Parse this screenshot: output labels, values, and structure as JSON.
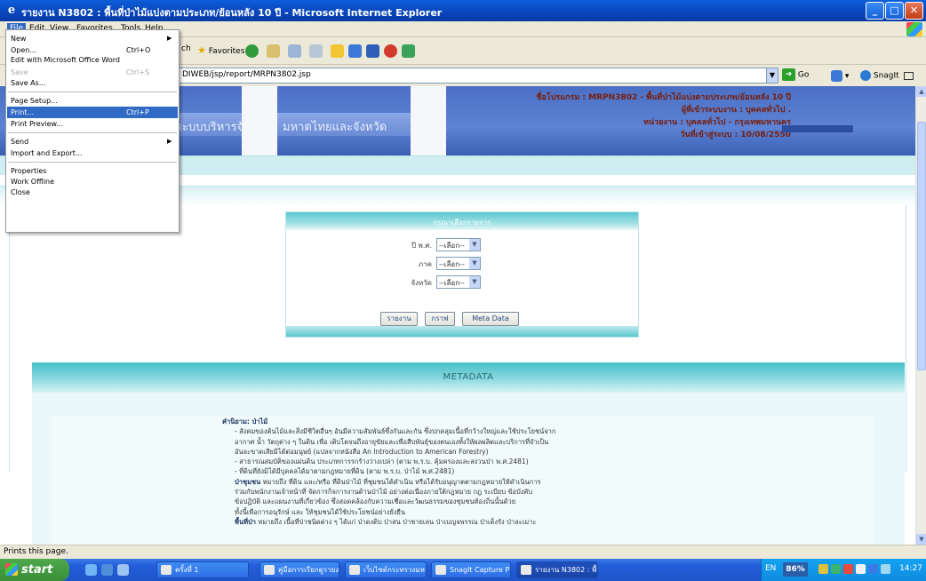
{
  "window": {
    "title": "รายงาน N3802 : พื้นที่ป่าไม้แบ่งตามประเภท/ย้อนหลัง 10 ปี - Microsoft Internet Explorer",
    "min_glyph": "_",
    "max_glyph": "□",
    "close_glyph": "✕"
  },
  "menubar": {
    "items": [
      "File",
      "Edit",
      "View",
      "Favorites",
      "Tools",
      "Help"
    ]
  },
  "toolbar": {
    "search_fragment": "ch",
    "favorites_label": "Favorites"
  },
  "address": {
    "value": "DIWEB/jsp/report/MRPN3802.jsp",
    "go_label": "Go",
    "snagit_label": "SnagIt"
  },
  "file_menu": {
    "new": "New",
    "open": "Open...",
    "open_sc": "Ctrl+O",
    "edit_office": "Edit with Microsoft Office Word",
    "save": "Save",
    "save_sc": "Ctrl+S",
    "save_as": "Save As...",
    "page_setup": "Page Setup...",
    "print": "Print...",
    "print_sc": "Ctrl+P",
    "print_preview": "Print Preview...",
    "send": "Send",
    "import_export": "Import and Export...",
    "properties": "Properties",
    "work_offline": "Work Offline",
    "close": "Close"
  },
  "banner": {
    "band_text_1": "ระบบบริหารจัดการ",
    "band_text_2": "มหาดไทยและจังหวัด",
    "program": "ชื่อโปรแกรม : MRPN3802 - พื้นที่ป่าไม้แบ่งตามประเภท/ย้อนหลัง 10 ปี",
    "user": "ผู้ที่เข้าระบบงาน : บุคคลทั่วไป .",
    "agency": "หน่วยงาน : บุคคลทั่วไป - กรุงเทพมหานคร",
    "date": "วันที่เข้าสู่ระบบ : 10/08/2550"
  },
  "form": {
    "header": "กรุณาเลือกรายการ",
    "year_label": "ปี พ.ศ.",
    "year_value": "--เลือก--",
    "region_label": "ภาค",
    "region_value": "--เลือก--",
    "province_label": "จังหวัด",
    "province_value": "--เลือก--",
    "report_btn": "รายงาน",
    "graph_btn": "กราฟ",
    "meta_btn": "Meta Data"
  },
  "metadata": {
    "heading": "METADATA",
    "l1_b": "คำนิยาม: ป่าไม้",
    "l2": "- สังคมของต้นไม้และสิ่งมีชีวิตอื่นๆ อันมีความสัมพันธ์ซึ่งกันและกัน ซึ่งปกคลุมเนื้อที่กว้างใหญ่และใช้ประโยชน์จาก",
    "l3": "อากาศ น้ำ วัตถุต่าง ๆ ในดิน เพื่อ เติบโตจนถึงอายุขัยและเพื่อสืบพันธุ์ของตนเองทั้งให้ผลผลิตและบริการที่จำเป็น",
    "l4": "อันจะขาดเสียมิได้ต่อมนุษย์ (แปลจากหนังสือ An Introduction to American Forestry)",
    "l5": "- สาธารณสมบัติของแผ่นดิน ประเภทการรกร้างว่างเปล่า (ตาม พ.ร.บ. คุ้มครองและสงวนป่า พ.ศ.2481)",
    "l6": "- ที่ดินที่ยังมิได้มีบุคคลได้มาตามกฎหมายที่ดิน (ตาม พ.ร.บ. ป่าไม้ พ.ศ.2481)",
    "l7_b": "ป่าชุมชน",
    "l7": " หมายถึง ที่ดิน และ/หรือ ที่ดินป่าไม้ ที่ชุมชนได้ดำเนิน หรือได้รับอนุญาตตามกฎหมายให้ดำเนินการ",
    "l8": "ร่วมกับพนักงานเจ้าหน้าที่ จัดการกิจการงานด้านป่าไม้ อย่างต่อเนื่องภายใต้กฎหมาย กฎ ระเบียบ ข้อบังคับ",
    "l9": "ข้อปฏิบัติ และแผนงานที่เกี่ยวข้อง ซึ่งสอดคล้องกับความเชื่อและวัฒนธรรมของชุมชนท้องถิ่นนั้นด้วย",
    "l10": "ทั้งนี้เพื่อการอนุรักษ์ และ ให้ชุมชนได้ใช้ประโยชน์อย่างยั่งยืน",
    "l11_b": "พื้นที่ป่า",
    "l11": " หมายถึง เนื้อที่ป่าชนิดต่าง ๆ ได้แก่ ป่าดงดิบ ป่าสน ป่าชายเลน ป่าเบญจพรรณ ป่าเต็งรัง ป่าละเมาะ"
  },
  "status": {
    "text": "Prints this page."
  },
  "taskbar": {
    "start": "start",
    "tasks": [
      "ครั้งที่ 1",
      "คู่มือการเรียกดูรายงาน...",
      "เว็บไซต์กระทรวงมหาด...",
      "SnagIt Capture Pre...",
      "รายงาน N3802 : พื้น..."
    ],
    "lang": "EN",
    "zoom": "86%",
    "clock": "14:27"
  }
}
